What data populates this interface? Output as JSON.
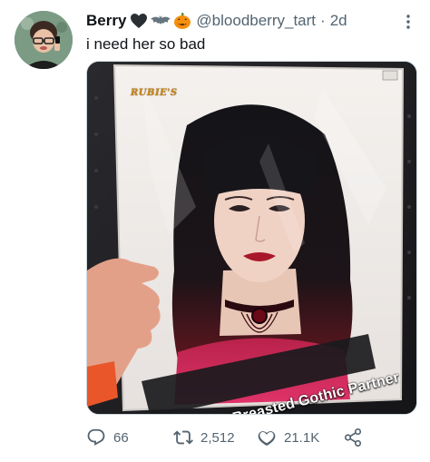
{
  "tweet": {
    "display_name": "Berry",
    "emojis": [
      "black-heart-icon",
      "bat-icon",
      "jack-o-lantern-icon"
    ],
    "handle": "@bloodberry_tart",
    "separator": "·",
    "timestamp": "2d",
    "text": "i need her so bad"
  },
  "media": {
    "brand_text": "RUBIE'S",
    "caption_text": "Ample Breasted Gothic Partner"
  },
  "actions": {
    "reply_count": "66",
    "retweet_count": "2,512",
    "like_count": "21.1K",
    "share_icon": "share-icon"
  },
  "colors": {
    "text_primary": "#0f1419",
    "text_secondary": "#536471",
    "border": "#cfd9de"
  }
}
